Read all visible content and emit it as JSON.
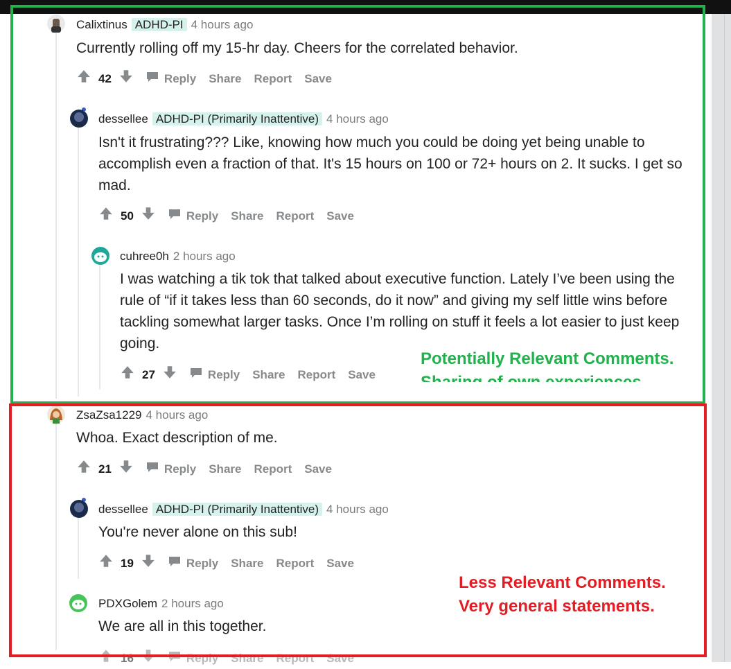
{
  "comments": [
    {
      "user": "Calixtinus",
      "flair": "ADHD-PI",
      "time": "4 hours ago",
      "body": "Currently rolling off my 15-hr day. Cheers for the correlated behavior.",
      "score": "42"
    },
    {
      "user": "dessellee",
      "flair": "ADHD-PI (Primarily Inattentive)",
      "time": "4 hours ago",
      "body": "Isn't it frustrating??? Like, knowing how much you could be doing yet being unable to accomplish even a fraction of that. It's 15 hours on 100 or 72+ hours on 2. It sucks. I get so mad.",
      "score": "50"
    },
    {
      "user": "cuhree0h",
      "time": "2 hours ago",
      "body": "I was watching a tik tok that talked about executive function. Lately I’ve been using the rule of “if it takes less than 60 seconds, do it now” and giving my self little wins before tackling somewhat larger tasks. Once I’m rolling on stuff it feels a lot easier to just keep going.",
      "score": "27"
    },
    {
      "user": "ZsaZsa1229",
      "time": "4 hours ago",
      "body": "Whoa. Exact description of me.",
      "score": "21"
    },
    {
      "user": "dessellee",
      "flair": "ADHD-PI (Primarily Inattentive)",
      "time": "4 hours ago",
      "body": "You're never alone on this sub!",
      "score": "19"
    },
    {
      "user": "PDXGolem",
      "time": "2 hours ago",
      "body": "We are all in this together.",
      "score": "16"
    }
  ],
  "actions": {
    "reply": "Reply",
    "share": "Share",
    "report": "Report",
    "save": "Save"
  },
  "annotations": {
    "green_line1": "Potentially Relevant Comments.",
    "green_line2": "Sharing of own experiences.",
    "red_line1": "Less Relevant Comments.",
    "red_line2": "Very general statements."
  },
  "colors": {
    "green": "#22b14c",
    "red": "#e41c23",
    "flair_bg": "#d5f3ec",
    "meta_gray": "#787c7e"
  }
}
